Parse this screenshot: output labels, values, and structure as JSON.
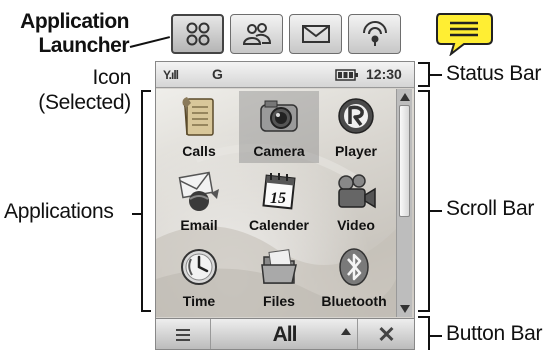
{
  "callouts": {
    "launcher": "Application Launcher",
    "launcher_line1": "Application",
    "launcher_line2": "Launcher",
    "icon_line1": "Icon",
    "icon_line2": "(Selected)",
    "applications": "Applications",
    "status_bar": "Status Bar",
    "scroll_bar": "Scroll Bar",
    "button_bar": "Button Bar"
  },
  "launcher_tabs": [
    {
      "icon": "app-grid-icon",
      "selected": true
    },
    {
      "icon": "contacts-icon",
      "selected": false
    },
    {
      "icon": "envelope-icon",
      "selected": false
    },
    {
      "icon": "web-icon",
      "selected": false
    }
  ],
  "notification_icon": "message-bubble-icon",
  "status": {
    "signal": "Y.ıll",
    "network": "G",
    "battery_icon": "battery-icon",
    "time": "12:30"
  },
  "apps": [
    {
      "label": "Calls",
      "icon": "calls-icon"
    },
    {
      "label": "Camera",
      "icon": "camera-icon",
      "selected": true
    },
    {
      "label": "Player",
      "icon": "player-icon"
    },
    {
      "label": "Email",
      "icon": "email-icon"
    },
    {
      "label": "Calender",
      "icon": "calendar-icon",
      "day": "15"
    },
    {
      "label": "Video",
      "icon": "video-icon"
    },
    {
      "label": "Time",
      "icon": "clock-icon"
    },
    {
      "label": "Files",
      "icon": "files-icon"
    },
    {
      "label": "Bluetooth",
      "icon": "bluetooth-icon"
    }
  ],
  "button_bar": {
    "menu_icon": "menu-icon",
    "filter_label": "All",
    "up_icon": "up-arrow-icon",
    "close_icon": "close-icon",
    "close_glyph": "✕"
  },
  "colors": {
    "bubble_fill": "#ffee33",
    "selected_highlight": "#8c8c8c"
  }
}
